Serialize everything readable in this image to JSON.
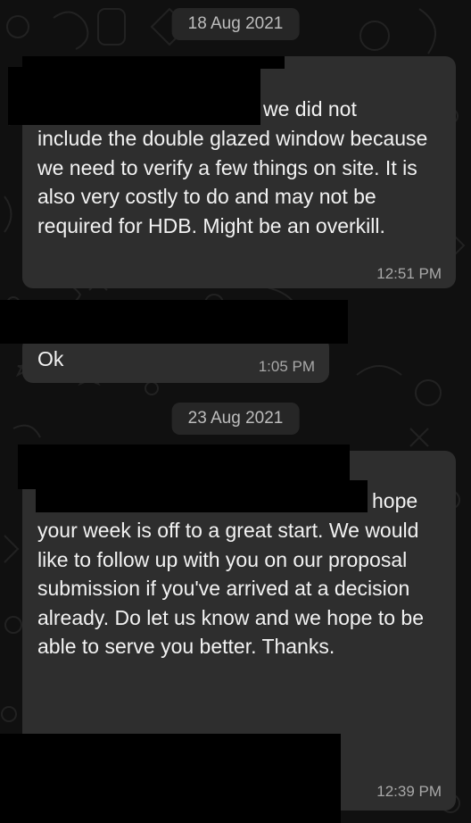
{
  "dates": [
    "18 Aug 2021",
    "23 Aug 2021"
  ],
  "messages": [
    {
      "lead": "we did not",
      "text": "include the double glazed window because we need to verify a few things on site. It is also very costly to do and may not be required for HDB. Might be an overkill.",
      "time": "12:51 PM"
    },
    {
      "text": "Ok",
      "time": "1:05 PM"
    },
    {
      "lead": "hope",
      "text": "your week is off to a great start. We would like to follow up with you on our proposal submission if you've arrived at a decision already. Do let us know and we hope to be able to serve you better. Thanks.",
      "time": "12:39 PM"
    }
  ],
  "colors": {
    "background": "#101010",
    "bubble": "#2e2e2e",
    "date_pill": "#262626",
    "text": "#f2f2f2",
    "timestamp": "#a8a8a8"
  }
}
